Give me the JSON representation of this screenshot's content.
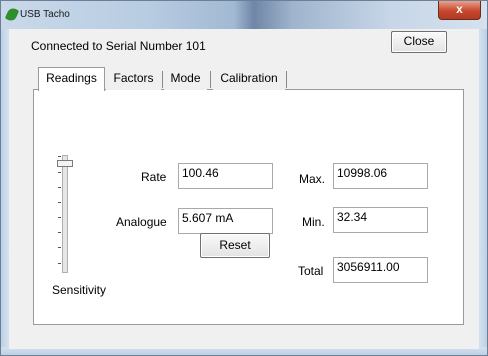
{
  "window": {
    "title": "USB Tacho",
    "close_glyph": "x"
  },
  "header": {
    "connection_text": "Connected to Serial Number 101",
    "close_label": "Close"
  },
  "tabs": [
    {
      "label": "Readings",
      "selected": true
    },
    {
      "label": "Factors",
      "selected": false
    },
    {
      "label": "Mode",
      "selected": false
    },
    {
      "label": "Calibration",
      "selected": false
    }
  ],
  "readings": {
    "rate_label": "Rate",
    "rate_value": "100.46",
    "analogue_label": "Analogue",
    "analogue_value": "5.607 mA",
    "max_label": "Max.",
    "max_value": "10998.06",
    "min_label": "Min.",
    "min_value": "32.34",
    "total_label": "Total",
    "total_value": "3056911.00",
    "reset_label": "Reset",
    "sensitivity_label": "Sensitivity"
  },
  "icons": {
    "app": "usb-tacho-app-icon",
    "close": "close-icon"
  }
}
